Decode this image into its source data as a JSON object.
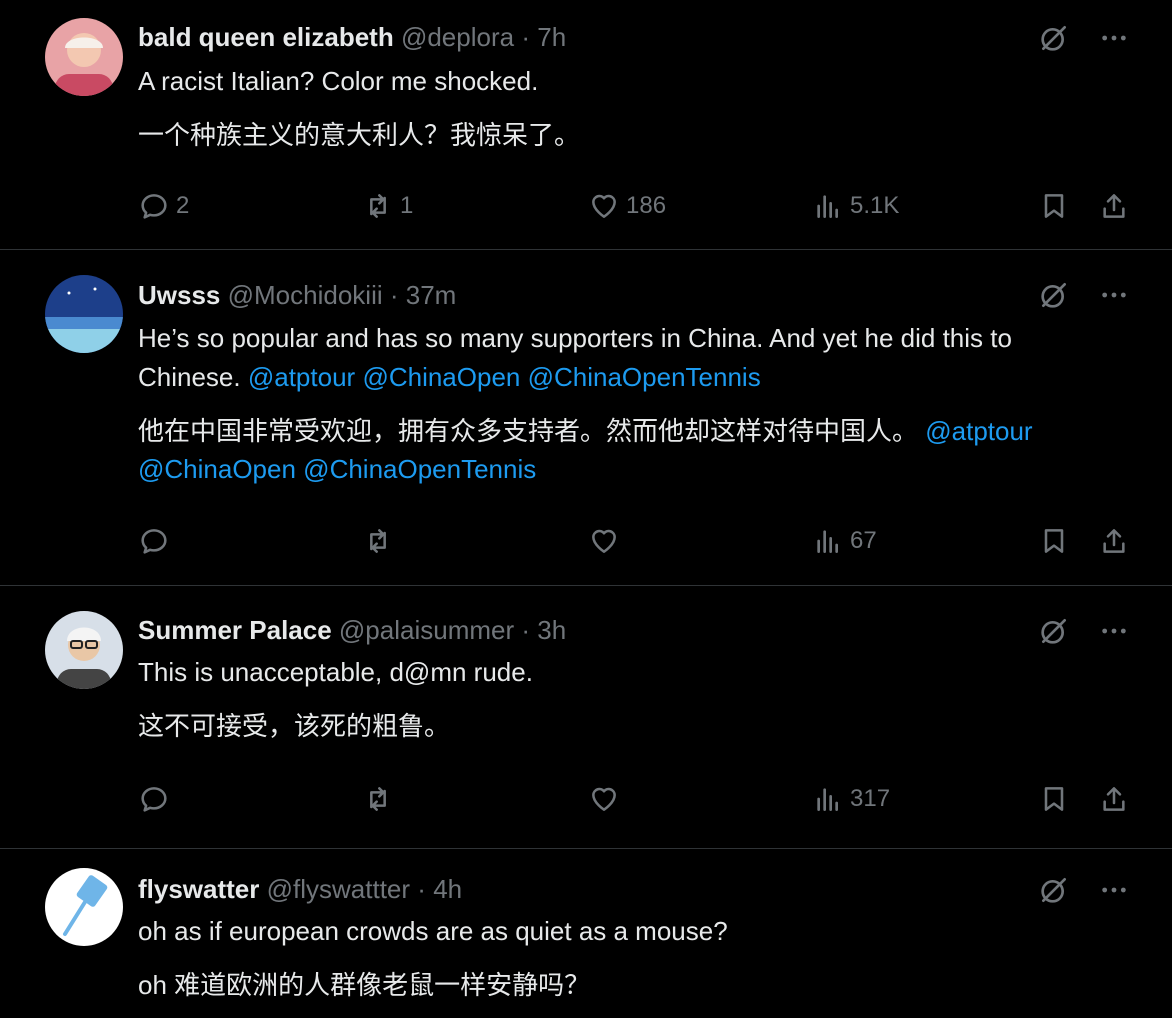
{
  "tweets": [
    {
      "name": "bald queen elizabeth",
      "handle": "@deplora",
      "dot": "·",
      "time": "7h",
      "text_en": "A racist Italian? Color me shocked.",
      "text_zh": "一个种族主义的意大利人？我惊呆了。",
      "replies": "2",
      "reposts": "1",
      "likes": "186",
      "views": "5.1K"
    },
    {
      "name": "Uwsss",
      "handle": "@Mochidokiii",
      "dot": "·",
      "time": "37m",
      "text_en_1": "He’s so popular and has so many supporters in China. And yet he did this to",
      "text_en_2": "Chinese.",
      "mentions_en": [
        "@atptour",
        "@ChinaOpen",
        "@ChinaOpenTennis"
      ],
      "text_zh_1": "他在中国非常受欢迎，拥有众多支持者。然而他却这样对待中国人。",
      "mentions_zh": [
        "@atptour",
        "@ChinaOpen",
        "@ChinaOpenTennis"
      ],
      "views": "67"
    },
    {
      "name": "Summer Palace",
      "handle": "@palaisummer",
      "dot": "·",
      "time": "3h",
      "text_en": "This is unacceptable, d@mn rude.",
      "text_zh": "这不可接受，该死的粗鲁。",
      "views": "317"
    },
    {
      "name": "flyswatter",
      "handle": "@flyswattter",
      "dot": "·",
      "time": "4h",
      "text_en": "oh as if european crowds are as quiet as a mouse?",
      "text_zh": "oh 难道欧洲的人群像老鼠一样安静吗？"
    }
  ],
  "colors": {
    "background": "#000000",
    "text": "#e7e9ea",
    "muted": "#71767b",
    "link": "#1d9bf0",
    "divider": "#2f3336"
  },
  "icons": [
    "grok-icon",
    "more-icon",
    "reply-icon",
    "repost-icon",
    "like-icon",
    "views-icon",
    "bookmark-icon",
    "share-icon"
  ]
}
